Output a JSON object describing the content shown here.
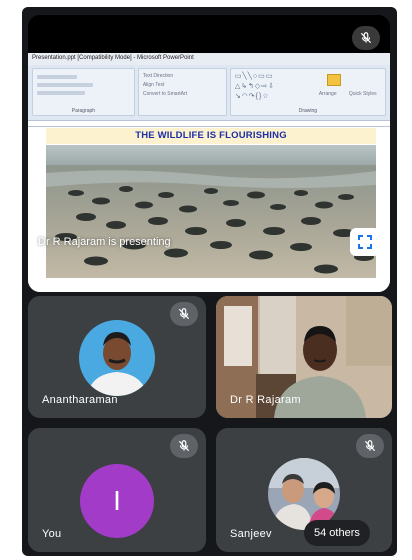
{
  "presentation": {
    "window_title": "Presentation.ppt [Compatibility Mode] - Microsoft PowerPoint",
    "ribbon": {
      "paragraph_label": "Paragraph",
      "drawing_label": "Drawing",
      "text_direction": "Text Direction",
      "align_text": "Align Text",
      "convert_smartart": "Convert to SmartArt",
      "arrange_label": "Arrange",
      "quick_styles": "Quick Styles"
    },
    "slide_title": "THE WILDLIFE IS FLOURISHING",
    "presenting_text": "Dr R Rajaram is presenting"
  },
  "participants": [
    {
      "name": "Anantharaman",
      "muted": true
    },
    {
      "name": "Dr R Rajaram",
      "muted": false
    },
    {
      "name": "You",
      "initial": "I",
      "avatar_color": "#a23cc8",
      "muted": true
    },
    {
      "name": "Sanjeev",
      "muted": true
    }
  ],
  "others": {
    "label": "54 others"
  },
  "icons": {
    "mic_off": "mic-off-icon",
    "fullscreen": "fullscreen-icon"
  }
}
